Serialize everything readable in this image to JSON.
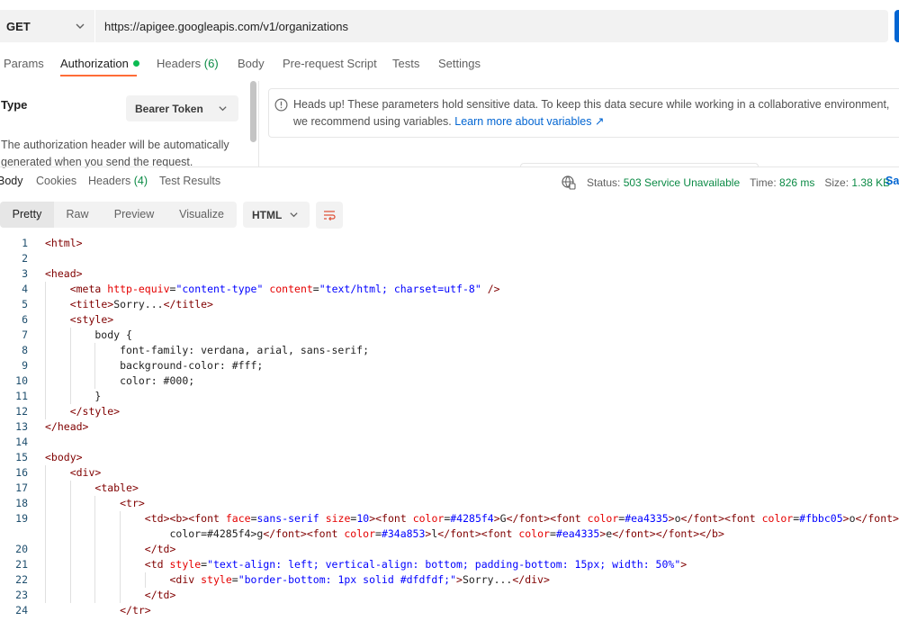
{
  "request": {
    "method": "GET",
    "url": "https://apigee.googleapis.com/v1/organizations"
  },
  "request_tabs": [
    {
      "label": "Params"
    },
    {
      "label": "Authorization"
    },
    {
      "label": "Headers",
      "count": "(6)"
    },
    {
      "label": "Body"
    },
    {
      "label": "Pre-request Script"
    },
    {
      "label": "Tests"
    },
    {
      "label": "Settings"
    }
  ],
  "auth": {
    "type_label": "Type",
    "type_value": "Bearer Token",
    "description": "The authorization header will be automatically generated when you send the request.",
    "notice_text": "Heads up! These parameters hold sensitive data. To keep this data secure while working in a collaborative environment, we recommend using variables.",
    "notice_link": "Learn more about variables ↗"
  },
  "response_tabs": [
    {
      "label": "Body"
    },
    {
      "label": "Cookies"
    },
    {
      "label": "Headers",
      "count": "(4)"
    },
    {
      "label": "Test Results"
    }
  ],
  "response_meta": {
    "status_label": "Status:",
    "status_value": "503 Service Unavailable",
    "time_label": "Time:",
    "time_value": "826 ms",
    "size_label": "Size:",
    "size_value": "1.38 KB",
    "save_label": "Sa"
  },
  "view_modes": [
    "Pretty",
    "Raw",
    "Preview",
    "Visualize"
  ],
  "format_value": "HTML",
  "code_lines": [
    {
      "n": "1",
      "text": "<html>"
    },
    {
      "n": "2",
      "text": ""
    },
    {
      "n": "3",
      "text": "<head>"
    },
    {
      "n": "4",
      "text": "    <meta http-equiv=\"content-type\" content=\"text/html; charset=utf-8\" />"
    },
    {
      "n": "5",
      "text": "    <title>Sorry...</title>"
    },
    {
      "n": "6",
      "text": "    <style>"
    },
    {
      "n": "7",
      "text": "        body {"
    },
    {
      "n": "8",
      "text": "            font-family: verdana, arial, sans-serif;"
    },
    {
      "n": "9",
      "text": "            background-color: #fff;"
    },
    {
      "n": "10",
      "text": "            color: #000;"
    },
    {
      "n": "11",
      "text": "        }"
    },
    {
      "n": "12",
      "text": "    </style>"
    },
    {
      "n": "13",
      "text": "</head>"
    },
    {
      "n": "14",
      "text": ""
    },
    {
      "n": "15",
      "text": "<body>"
    },
    {
      "n": "16",
      "text": "    <div>"
    },
    {
      "n": "17",
      "text": "        <table>"
    },
    {
      "n": "18",
      "text": "            <tr>"
    },
    {
      "n": "19",
      "text": "                <td><b><font face=sans-serif size=10><font color=#4285f4>G</font><font color=#ea4335>o</font><font color=#fbbc05>o</font><fo"
    },
    {
      "n": "",
      "text": "                    color=#4285f4>g</font><font color=#34a853>l</font><font color=#ea4335>e</font></font></b>"
    },
    {
      "n": "20",
      "text": "                </td>"
    },
    {
      "n": "21",
      "text": "                <td style=\"text-align: left; vertical-align: bottom; padding-bottom: 15px; width: 50%\">"
    },
    {
      "n": "22",
      "text": "                    <div style=\"border-bottom: 1px solid #dfdfdf;\">Sorry...</div>"
    },
    {
      "n": "23",
      "text": "                </td>"
    },
    {
      "n": "24",
      "text": "            </tr>"
    }
  ]
}
